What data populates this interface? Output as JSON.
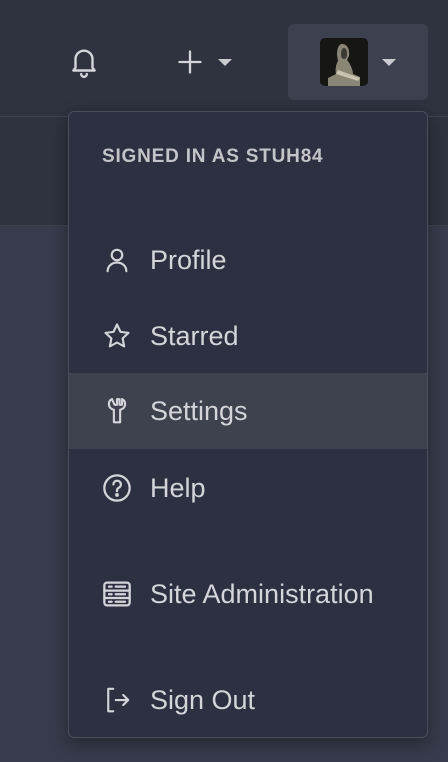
{
  "header": {
    "notifications_icon": "bell-icon",
    "create_icon": "plus-icon",
    "user_avatar_alt": "avatar"
  },
  "user_menu": {
    "header": "SIGNED IN AS STUH84",
    "items": [
      {
        "label": "Profile",
        "icon": "person-icon"
      },
      {
        "label": "Starred",
        "icon": "star-icon"
      },
      {
        "label": "Settings",
        "icon": "wrench-icon",
        "active": true
      },
      {
        "label": "Help",
        "icon": "question-circle-icon"
      },
      {
        "label": "Site Administration",
        "icon": "server-icon"
      },
      {
        "label": "Sign Out",
        "icon": "sign-out-icon"
      }
    ]
  },
  "colors": {
    "background": "#383b4b",
    "bar": "#2f323f",
    "menu_bg": "#2d3040",
    "active_item": "#3e414e",
    "text": "#d3d5da"
  }
}
